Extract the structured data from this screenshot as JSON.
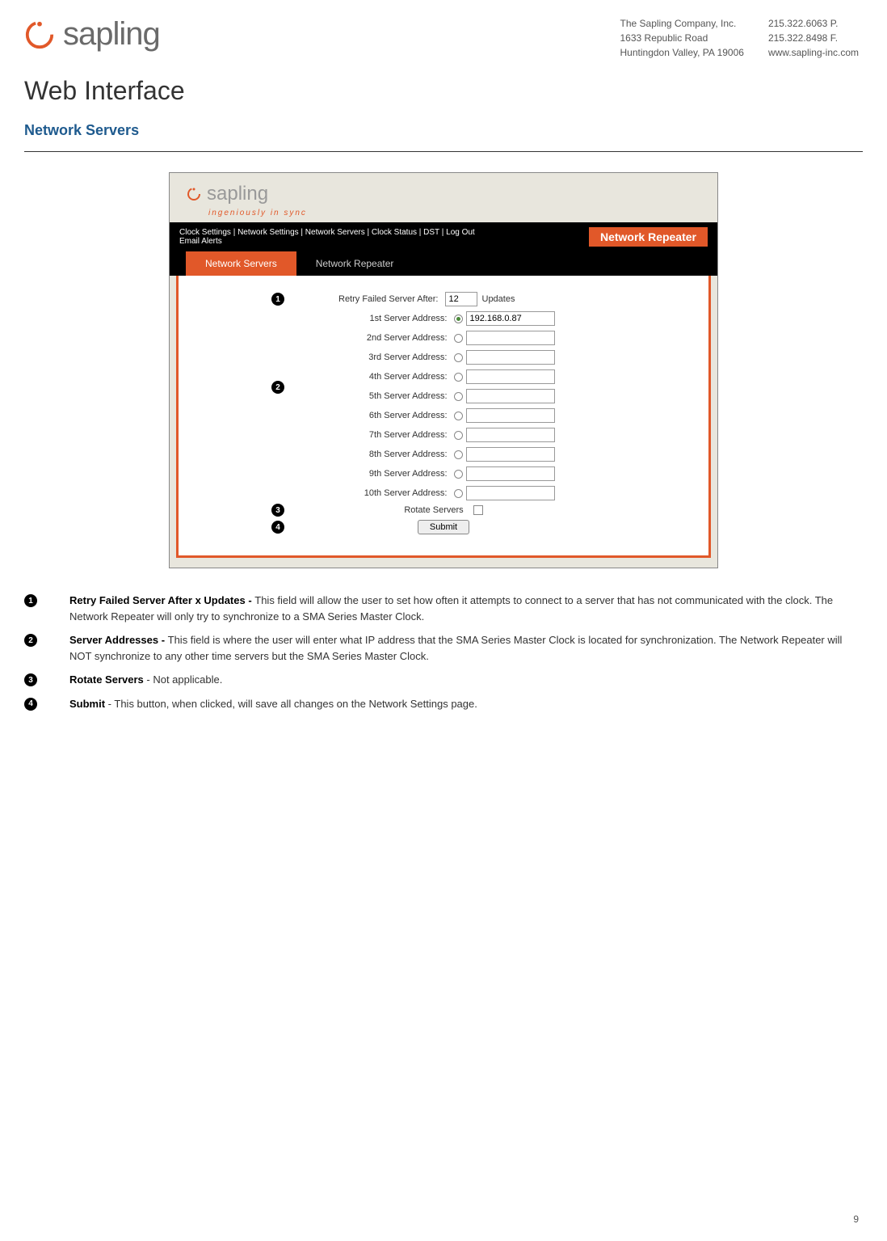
{
  "header": {
    "logo_text": "sapling",
    "company": {
      "name": "The Sapling Company, Inc.",
      "address1": "1633 Republic Road",
      "address2": "Huntingdon Valley, PA 19006",
      "phone": "215.322.6063 P.",
      "fax": "215.322.8498 F.",
      "web": "www.sapling-inc.com"
    }
  },
  "title": "Web Interface",
  "section": "Network Servers",
  "screenshot": {
    "logo_text": "sapling",
    "tagline": "ingeniously in sync",
    "nav": "Clock Settings | Network Settings | Network Servers | Clock Status | DST | Log Out",
    "nav_sub": "Email Alerts",
    "nav_title": "Network Repeater",
    "tabs": {
      "active": "Network Servers",
      "inactive": "Network Repeater"
    },
    "form": {
      "retry_label": "Retry Failed Server After:",
      "retry_value": "12",
      "updates_label": "Updates",
      "server_labels": [
        "1st Server Address:",
        "2nd Server Address:",
        "3rd Server Address:",
        "4th Server Address:",
        "5th Server Address:",
        "6th Server Address:",
        "7th Server Address:",
        "8th Server Address:",
        "9th Server Address:",
        "10th Server Address:"
      ],
      "server1_value": "192.168.0.87",
      "rotate_label": "Rotate Servers",
      "submit_label": "Submit"
    }
  },
  "descriptions": [
    {
      "num": "1",
      "bold": "Retry Failed Server After x Updates - ",
      "text": "This field will allow the user to set how often it attempts to connect to a server that has not communicated with the clock.  The Network Repeater will only try to synchronize to a SMA Series Master Clock."
    },
    {
      "num": "2",
      "bold": "Server Addresses - ",
      "text": "This field is where the user will enter what IP address that the SMA Series Master Clock is located for synchronization.  The Network Repeater will NOT synchronize to any other time servers but the SMA Series Master Clock."
    },
    {
      "num": "3",
      "bold": "Rotate Servers",
      "text": " - Not applicable."
    },
    {
      "num": "4",
      "bold": "Submit",
      "text": " - This button, when clicked, will save all changes on the Network Settings page."
    }
  ],
  "page_number": "9"
}
